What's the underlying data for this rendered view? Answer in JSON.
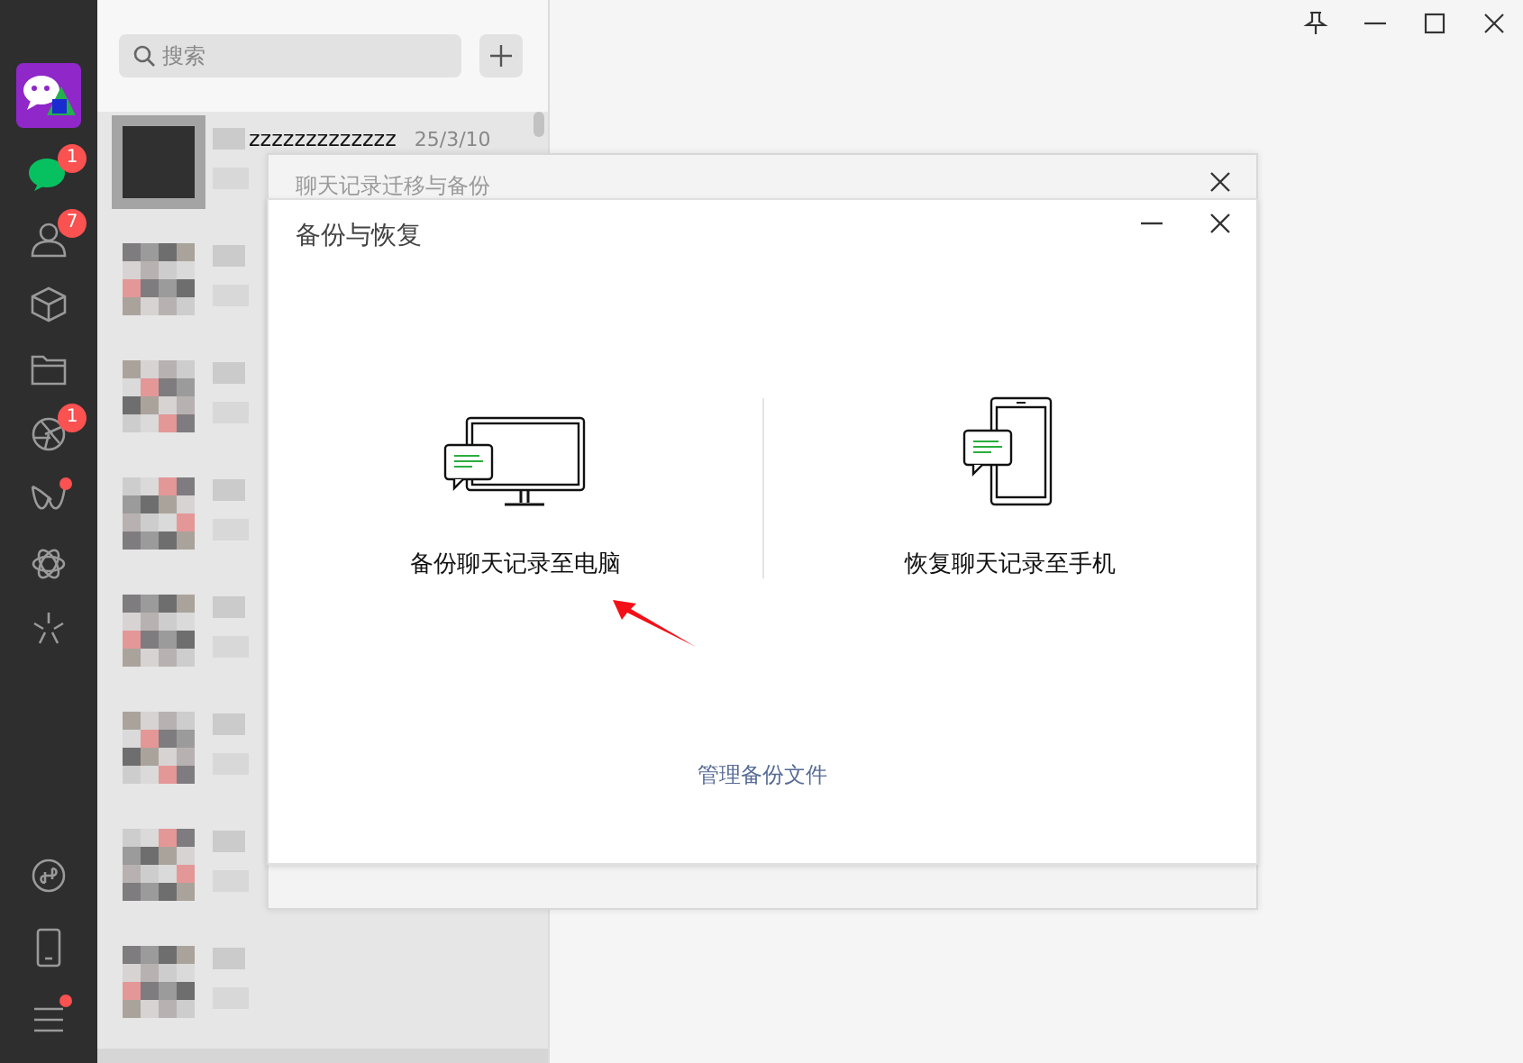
{
  "sidebar": {
    "items": [
      {
        "kind": "chat",
        "badge": "1",
        "dot": false,
        "selected": true
      },
      {
        "kind": "contacts",
        "badge": "7",
        "dot": false,
        "selected": false
      },
      {
        "kind": "box",
        "dot": false,
        "selected": false
      },
      {
        "kind": "folder",
        "dot": false,
        "selected": false
      },
      {
        "kind": "aperture",
        "badge": "1",
        "dot": false,
        "selected": false
      },
      {
        "kind": "wave",
        "dot": true,
        "selected": false
      },
      {
        "kind": "flower",
        "dot": false,
        "selected": false
      },
      {
        "kind": "spark",
        "dot": false,
        "selected": false
      }
    ],
    "bottom_items": [
      {
        "kind": "miniapp",
        "dot": false,
        "selected": false
      },
      {
        "kind": "phone",
        "dot": false,
        "selected": false
      },
      {
        "kind": "menu",
        "dot": true,
        "selected": false
      }
    ]
  },
  "chat_list": {
    "search": {
      "placeholder": "搜索"
    },
    "rows": [
      {
        "name": "zzzzzzzzzzzzz",
        "time": "25/3/10",
        "selected": false
      },
      {
        "selected": false
      },
      {
        "selected": false
      },
      {
        "selected": false
      },
      {
        "selected": false
      },
      {
        "selected": false
      },
      {
        "selected": false
      },
      {
        "selected": false
      },
      {
        "selected": true
      }
    ]
  },
  "back_dialog": {
    "title": "聊天记录迁移与备份"
  },
  "dialog": {
    "title": "备份与恢复",
    "options": [
      {
        "kind": "computer",
        "label": "备份聊天记录至电脑"
      },
      {
        "kind": "phone",
        "label": "恢复聊天记录至手机"
      }
    ],
    "link": "管理备份文件"
  }
}
